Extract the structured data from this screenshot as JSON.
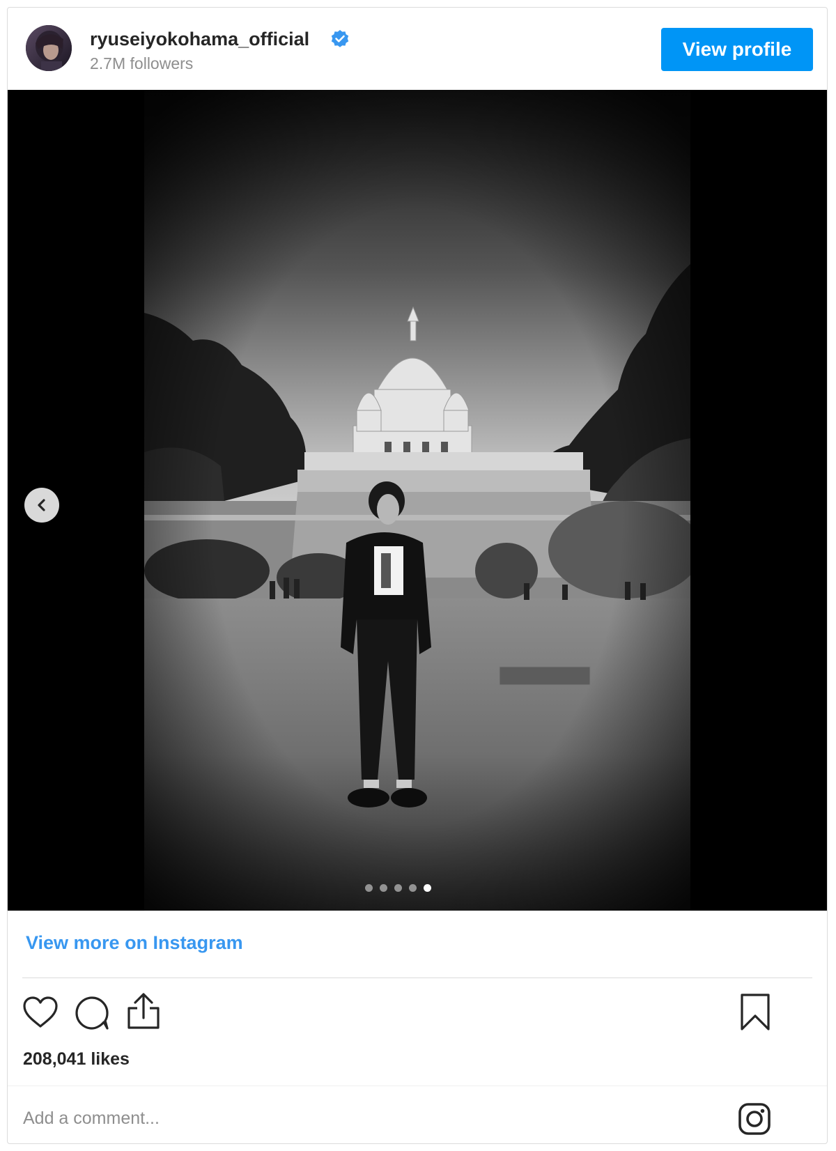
{
  "post": {
    "username": "ryuseiyokohama_official",
    "followers": "2.7M followers",
    "view_profile_label": "View profile",
    "view_more_label": "View more on Instagram",
    "likes": "208,041 likes",
    "comment_placeholder": "Add a comment...",
    "carousel": {
      "total": 5,
      "active": 5
    }
  },
  "colors": {
    "accent": "#0095f6",
    "link": "#3897f0",
    "verified": "#3897f0"
  },
  "icons": {
    "verified": "verified-badge-icon",
    "prev": "chevron-left-icon",
    "like": "heart-icon",
    "comment": "comment-icon",
    "share": "share-icon",
    "save": "bookmark-icon",
    "brand": "instagram-icon"
  }
}
